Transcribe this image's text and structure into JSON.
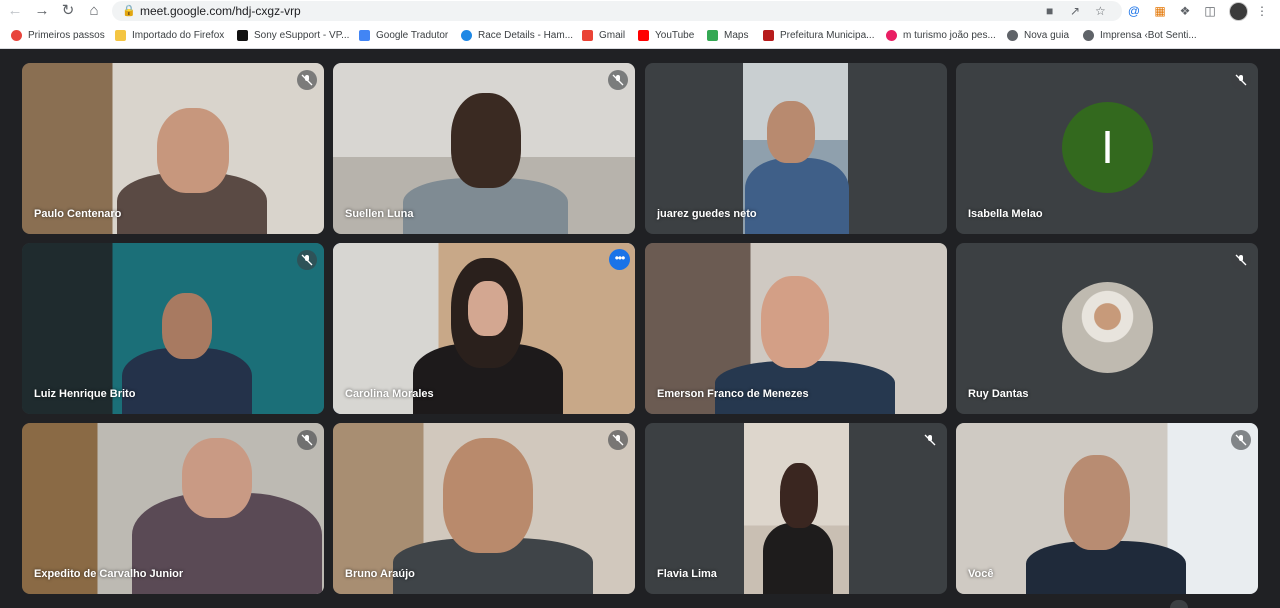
{
  "browser": {
    "url": "meet.google.com/hdj-cxgz-vrp",
    "bookmarks": [
      {
        "label": "Primeiros passos",
        "color": "#e8453c"
      },
      {
        "label": "Importado do Firefox",
        "color": "#f4c542"
      },
      {
        "label": "Sony eSupport - VP...",
        "color": "#111111"
      },
      {
        "label": "Google Tradutor",
        "color": "#4285f4"
      },
      {
        "label": "Race Details - Ham...",
        "color": "#1e88e5"
      },
      {
        "label": "Gmail",
        "color": "#ea4335"
      },
      {
        "label": "YouTube",
        "color": "#ff0000"
      },
      {
        "label": "Maps",
        "color": "#34a853"
      },
      {
        "label": "Prefeitura Municipa...",
        "color": "#b71c1c"
      },
      {
        "label": "m turismo joão pes...",
        "color": "#e91e63"
      },
      {
        "label": "Nova guia",
        "color": "#5f6368"
      },
      {
        "label": "Imprensa ‹Bot Senti...",
        "color": "#5f6368"
      }
    ]
  },
  "meeting": {
    "participants": [
      {
        "name": "Paulo Centenaro",
        "muted": true
      },
      {
        "name": "Suellen Luna",
        "muted": true
      },
      {
        "name": "juarez guedes neto",
        "muted": false
      },
      {
        "name": "Isabella Melao",
        "muted": true,
        "avatar_letter": "I"
      },
      {
        "name": "Luiz Henrique Brito",
        "muted": true
      },
      {
        "name": "Carolina Morales",
        "muted": false,
        "active": true
      },
      {
        "name": "Emerson Franco de Menezes",
        "muted": false
      },
      {
        "name": "Ruy Dantas",
        "muted": true
      },
      {
        "name": "Expedito de Carvalho Junior",
        "muted": true
      },
      {
        "name": "Bruno Araújo",
        "muted": true
      },
      {
        "name": "Flavia Lima",
        "muted": true
      },
      {
        "name": "Você",
        "muted": true
      }
    ],
    "colors": {
      "background": "#202124",
      "tile": "#3c4043",
      "accent": "#1a73e8"
    }
  }
}
